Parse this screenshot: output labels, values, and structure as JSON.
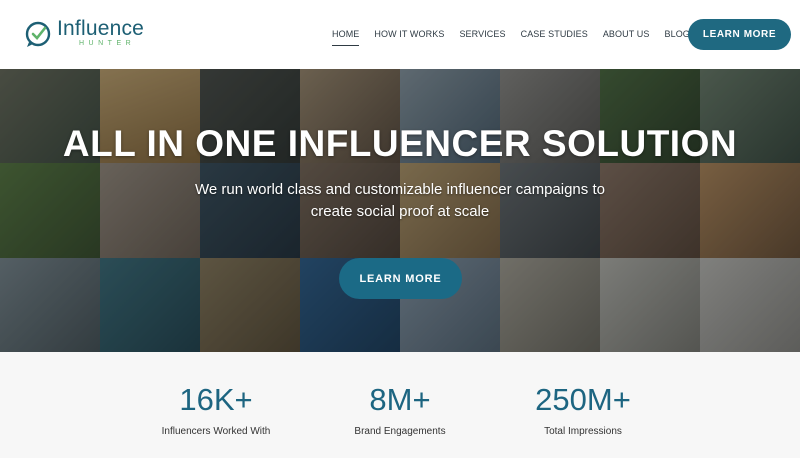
{
  "brand": {
    "name": "Influence",
    "sub": "HUNTER",
    "colors": {
      "primary": "#1f6981",
      "accent": "#5fb36a"
    }
  },
  "nav": {
    "items": [
      "HOME",
      "HOW IT WORKS",
      "SERVICES",
      "CASE STUDIES",
      "ABOUT US",
      "BLOG"
    ],
    "active": "HOME"
  },
  "header": {
    "cta_label": "LEARN MORE"
  },
  "hero": {
    "title": "ALL IN ONE INFLUENCER SOLUTION",
    "subtitle_line1": "We run world class and customizable influencer campaigns to",
    "subtitle_line2": "create social proof at scale",
    "cta_label": "LEARN MORE"
  },
  "stats": [
    {
      "value": "16K+",
      "label": "Influencers Worked With"
    },
    {
      "value": "8M+",
      "label": "Brand Engagements"
    },
    {
      "value": "250M+",
      "label": "Total Impressions"
    }
  ]
}
